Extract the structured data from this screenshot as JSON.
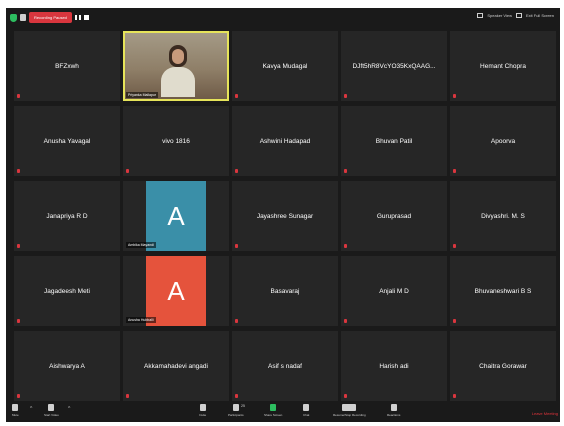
{
  "topbar": {
    "recording_label": "Recording Paused",
    "speaker_view_label": "Speaker View",
    "full_screen_label": "Exit Full Screen"
  },
  "tiles": [
    {
      "name": "BFZxwh"
    },
    {
      "name": "Priyanka Mallapur"
    },
    {
      "name": "Kavya Mudagal"
    },
    {
      "name": "DJft5hR8VcYO35KxQAAG..."
    },
    {
      "name": "Hemant Chopra"
    },
    {
      "name": "Anusha Yavagal"
    },
    {
      "name": "vivo 1816"
    },
    {
      "name": "Ashwini Hadapad"
    },
    {
      "name": "Bhuvan Patil"
    },
    {
      "name": "Apoorva"
    },
    {
      "name": "Janapriya R D"
    },
    {
      "name": "Ambika Mayandi",
      "initial": "A",
      "color": "#3a8fa8"
    },
    {
      "name": "Jayashree Sunagar"
    },
    {
      "name": "Guruprasad"
    },
    {
      "name": "Divyashri. M. S"
    },
    {
      "name": "Jagadeesh Meti"
    },
    {
      "name": "Anusha Hubballi",
      "initial": "A",
      "color": "#e5533c"
    },
    {
      "name": "Basavaraj"
    },
    {
      "name": "Anjali M D"
    },
    {
      "name": "Bhuvaneshwari B S"
    },
    {
      "name": "Aishwarya A"
    },
    {
      "name": "Akkamahadevi angadi"
    },
    {
      "name": "Asif s nadaf"
    },
    {
      "name": "Harish adi"
    },
    {
      "name": "Chaitra Gorawar"
    }
  ],
  "toolbar": {
    "mute": "Mute",
    "start_video": "Start Video",
    "invite": "Invite",
    "participants": "Participants",
    "participants_count": "25",
    "share_screen": "Share Screen",
    "chat": "Chat",
    "record": "Resume/Stop Recording",
    "reactions": "Reactions",
    "leave": "Leave Meeting"
  },
  "colors": {
    "background": "#1a1a1a",
    "tile": "#262626",
    "active_speaker": "#e6e45a",
    "recording": "#d9363e",
    "leave": "#e0343c"
  }
}
